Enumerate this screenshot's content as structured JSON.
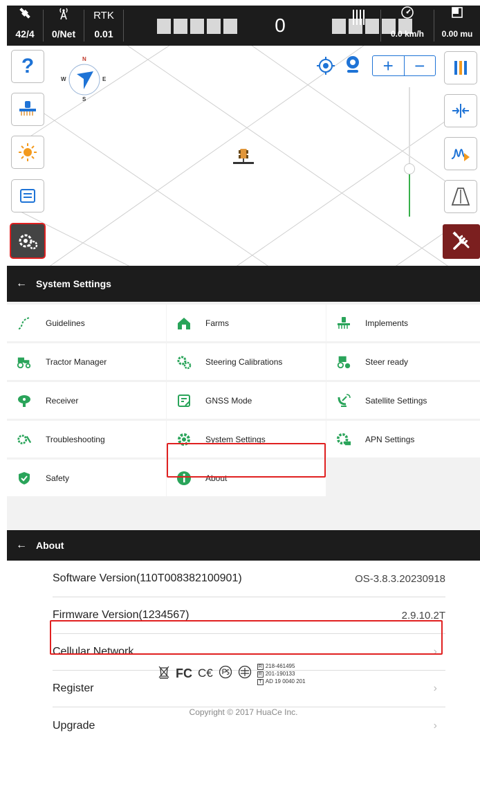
{
  "status_bar": {
    "satellites": "42/4",
    "network": "0/Net",
    "rtk_label": "RTK",
    "rtk_value": "0.01",
    "lightbar_value": "0",
    "speed": "0.0 km/h",
    "area": "0.00 mu",
    "icons": [
      "satellite-icon",
      "antenna-icon",
      "signal-bars-icon",
      "speedometer-icon",
      "area-icon"
    ]
  },
  "compass": {
    "n": "N",
    "s": "S",
    "e": "E",
    "w": "W"
  },
  "map_controls": {
    "left": [
      "help-icon",
      "implement-icon",
      "brightness-icon",
      "route-icon",
      "settings-gear-icon"
    ],
    "right": [
      "signal-strength-icon",
      "offset-icon",
      "wave-icon",
      "lane-icon",
      "tools-icon"
    ],
    "zoom_in": "+",
    "zoom_out": "−"
  },
  "settings": {
    "title": "System Settings",
    "items": [
      {
        "label": "Guidelines"
      },
      {
        "label": "Farms"
      },
      {
        "label": "Implements"
      },
      {
        "label": "Tractor Manager"
      },
      {
        "label": "Steering Calibrations"
      },
      {
        "label": "Steer ready"
      },
      {
        "label": "Receiver"
      },
      {
        "label": "GNSS Mode"
      },
      {
        "label": "Satellite Settings"
      },
      {
        "label": "Troubleshooting"
      },
      {
        "label": "System Settings"
      },
      {
        "label": "APN Settings"
      },
      {
        "label": "Safety"
      },
      {
        "label": "About"
      }
    ]
  },
  "about": {
    "title": "About",
    "rows": [
      {
        "label": "Software Version(110T008382100901)",
        "value": "OS-3.8.3.20230918"
      },
      {
        "label": "Firmware Version(1234567)",
        "value": "2.9.10.2T"
      },
      {
        "label": "Cellular Network",
        "value": ""
      },
      {
        "label": "Register",
        "value": ""
      },
      {
        "label": "Upgrade",
        "value": ""
      }
    ],
    "cert_codes": [
      "218-461495",
      "201-190133",
      "AD 19 0040 201"
    ],
    "cert_letters": [
      "R",
      "R",
      "T"
    ],
    "copyright": "Copyright © 2017 HuaCe Inc."
  },
  "colors": {
    "accent_green": "#2aa45a",
    "highlight_red": "#e02020",
    "header_dark": "#1c1c1c",
    "map_blue": "#1e73d6"
  }
}
